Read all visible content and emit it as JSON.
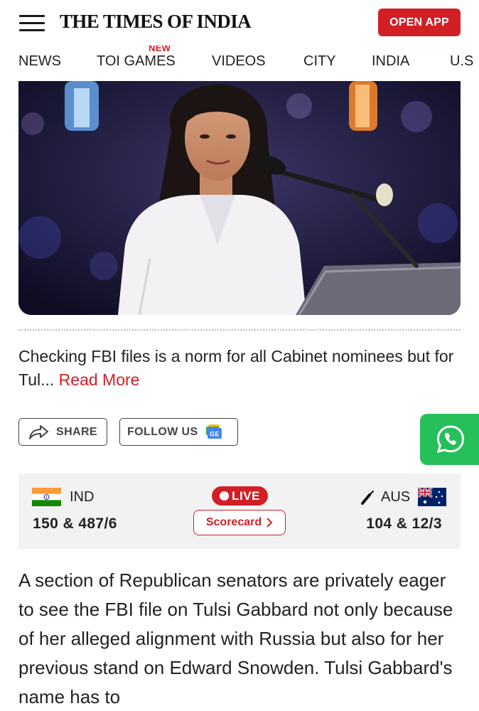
{
  "header": {
    "logo": "THE TIMES OF INDIA",
    "open_app": "OPEN APP",
    "menu_icon": "hamburger-menu-icon"
  },
  "nav": {
    "items": [
      "NEWS",
      "TOI GAMES",
      "VIDEOS",
      "CITY",
      "INDIA",
      "U.S"
    ],
    "new_badge": "NEW"
  },
  "hero": {
    "image": "photo of a woman in a white blazer speaking at a microphone"
  },
  "caption": {
    "text": "Checking FBI files is a norm for all Cabinet nominees but for Tul...",
    "read_more": " Read More"
  },
  "actions": {
    "share_label": "SHARE",
    "share_icon": "share-arrow-icon",
    "follow_label": "FOLLOW US",
    "follow_icon": "google-news-icon",
    "whatsapp_icon": "whatsapp-icon"
  },
  "score": {
    "team_left": "IND",
    "score_left": "150 & 487/6",
    "live_label": "LIVE",
    "scorecard_label": "Scorecard",
    "team_right": "AUS",
    "score_right": "104 & 12/3",
    "colors": {
      "live": "#d21f26"
    }
  },
  "article": {
    "text": "A section of Republican senators are privately eager to see the FBI file on Tulsi Gabbard not only because of her alleged alignment with Russia but also for her previous stand on Edward Snowden. Tulsi Gabbard's name has to"
  },
  "colors": {
    "brand_red": "#d21f26",
    "whatsapp_green": "#25c05a"
  }
}
